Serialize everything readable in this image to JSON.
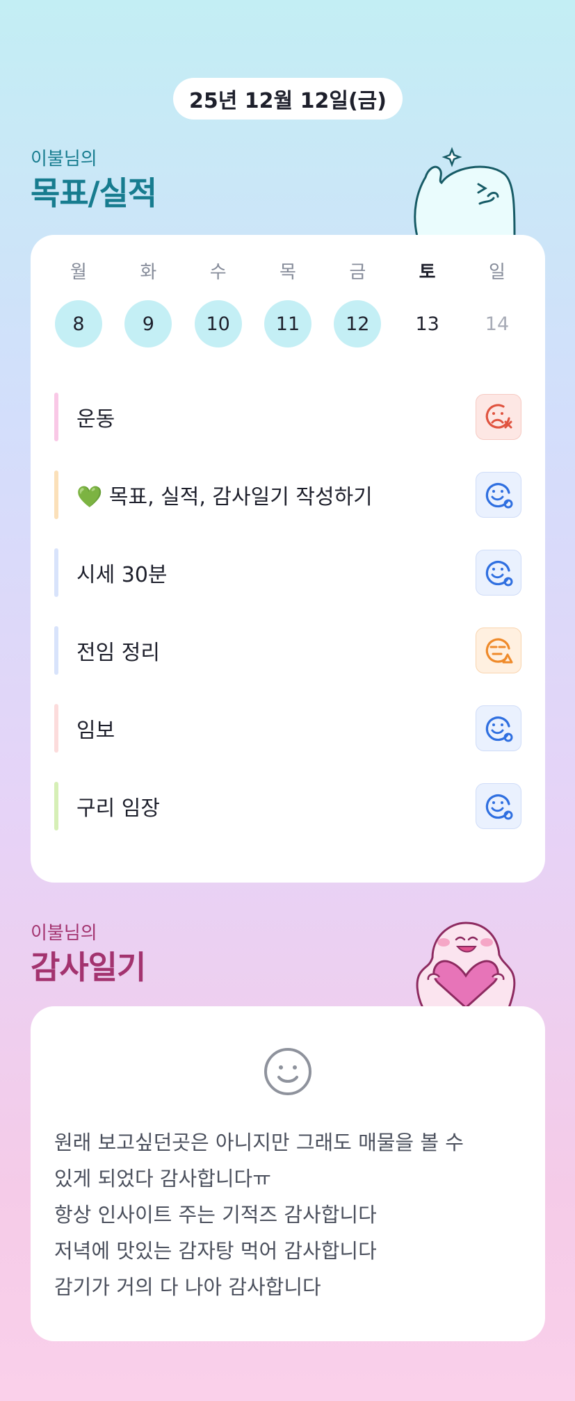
{
  "header": {
    "date": "25년 12월 12일(금)"
  },
  "goals_section": {
    "subtitle": "이불님의",
    "title": "목표/실적",
    "week": [
      {
        "day": "월",
        "date": "8"
      },
      {
        "day": "화",
        "date": "9"
      },
      {
        "day": "수",
        "date": "10"
      },
      {
        "day": "목",
        "date": "11"
      },
      {
        "day": "금",
        "date": "12"
      },
      {
        "day": "토",
        "date": "13"
      },
      {
        "day": "일",
        "date": "14"
      }
    ],
    "items": [
      {
        "label": "운동",
        "bar_color": "#f9c8e6",
        "status": "sad-x-icon"
      },
      {
        "label": "💚 목표, 실적, 감사일기 작성하기",
        "bar_color": "#fbe0b9",
        "status": "smile-circle-icon"
      },
      {
        "label": "시세 30분",
        "bar_color": "#d8e3fb",
        "status": "smile-circle-icon"
      },
      {
        "label": "전임 정리",
        "bar_color": "#d8e3fb",
        "status": "neutral-triangle-icon"
      },
      {
        "label": "임보",
        "bar_color": "#fcdcdc",
        "status": "smile-circle-icon"
      },
      {
        "label": "구리 임장",
        "bar_color": "#d6efb6",
        "status": "smile-circle-icon"
      }
    ]
  },
  "gratitude_section": {
    "subtitle": "이불님의",
    "title": "감사일기",
    "lines": [
      "원래 보고싶던곳은 아니지만 그래도 매물을 볼 수",
      "있게 되었다 감사합니다ㅠ",
      "항상 인사이트 주는 기적즈 감사합니다",
      "저녁에 맛있는 감자탕 먹어 감사합니다",
      "감기가 거의 다 나아 감사합니다"
    ]
  },
  "colors": {
    "accent_teal": "#177c8f",
    "accent_plum": "#a3336f",
    "completed_day": "#c4eff5",
    "good_status": "#2f6fe0",
    "bad_status": "#e0533f",
    "mid_status": "#ef8a2a"
  }
}
